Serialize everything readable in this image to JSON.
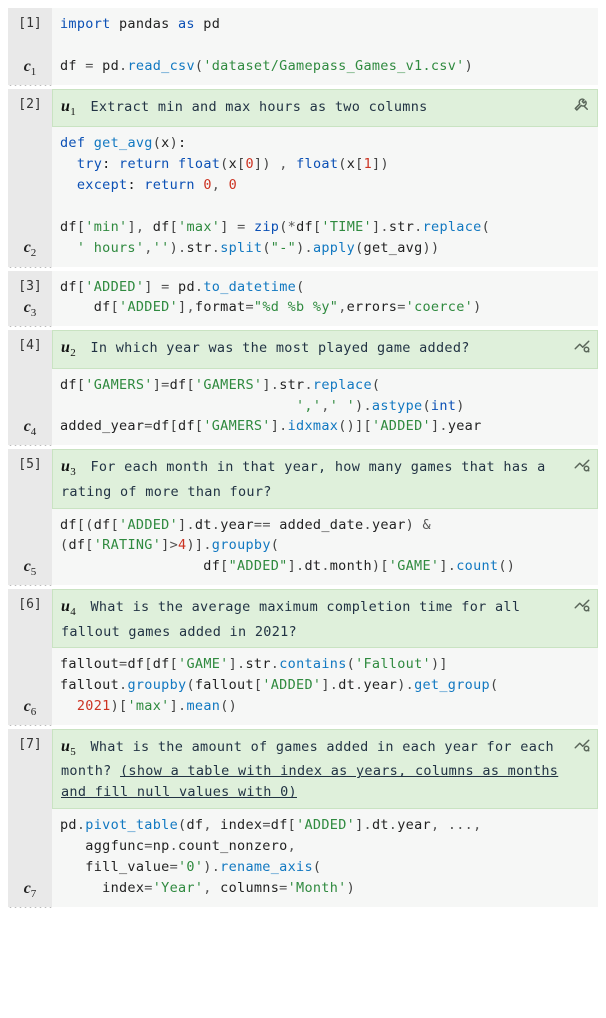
{
  "cells": [
    {
      "idx": "[1]",
      "clabel": "c",
      "csub": "1",
      "code_html": "<span class='line'><span class='kw'>import</span> pandas <span class='kw'>as</span> pd</span><span class='line'> </span><span class='line'>df <span class='op'>=</span> pd<span class='op'>.</span><span class='fn'>read_csv</span><span class='paren'>(</span><span class='st'>'dataset/Gamepass_Games_v1.csv'</span><span class='paren'>)</span></span>"
    },
    {
      "idx": "[2]",
      "clabel": "c",
      "csub": "2",
      "ulabel": "u",
      "usub": "1",
      "utter": "Extract min and max hours as two columns",
      "icon": "tools",
      "code_html": "<span class='line'><span class='kw'>def</span> <span class='fn'>get_avg</span><span class='paren'>(</span>x<span class='paren'>)</span>:</span><span class='line'>  <span class='kw'>try</span>: <span class='kw'>return</span> <span class='blt'>float</span><span class='paren'>(</span>x<span class='paren'>[</span><span class='num'>0</span><span class='paren'>]</span><span class='paren'>)</span> <span class='op'>,</span> <span class='blt'>float</span><span class='paren'>(</span>x<span class='paren'>[</span><span class='num'>1</span><span class='paren'>]</span><span class='paren'>)</span></span><span class='line'>  <span class='kw'>except</span>: <span class='kw'>return</span> <span class='num'>0</span><span class='op'>,</span> <span class='num'>0</span></span><span class='line'> </span><span class='line'>df<span class='paren'>[</span><span class='st'>'min'</span><span class='paren'>]</span><span class='op'>,</span> df<span class='paren'>[</span><span class='st'>'max'</span><span class='paren'>]</span> <span class='op'>=</span> <span class='blt'>zip</span><span class='paren'>(</span><span class='op'>*</span>df<span class='paren'>[</span><span class='st'>'TIME'</span><span class='paren'>]</span><span class='op'>.</span>str<span class='op'>.</span><span class='fn'>replace</span><span class='paren'>(</span></span><span class='line'>  <span class='st'>' hours'</span><span class='op'>,</span><span class='st'>''</span><span class='paren'>)</span><span class='op'>.</span>str<span class='op'>.</span><span class='fn'>split</span><span class='paren'>(</span><span class='st'>\"-\"</span><span class='paren'>)</span><span class='op'>.</span><span class='fn'>apply</span><span class='paren'>(</span>get_avg<span class='paren'>)</span><span class='paren'>)</span></span>"
    },
    {
      "idx": "[3]",
      "clabel": "c",
      "csub": "3",
      "code_html": "<span class='line'>df<span class='paren'>[</span><span class='st'>'ADDED'</span><span class='paren'>]</span> <span class='op'>=</span> pd<span class='op'>.</span><span class='fn'>to_datetime</span><span class='paren'>(</span></span><span class='line'>    df<span class='paren'>[</span><span class='st'>'ADDED'</span><span class='paren'>]</span><span class='op'>,</span>format<span class='op'>=</span><span class='st'>\"%d %b %y\"</span><span class='op'>,</span>errors<span class='op'>=</span><span class='st'>'coerce'</span><span class='paren'>)</span></span>"
    },
    {
      "idx": "[4]",
      "clabel": "c",
      "csub": "4",
      "ulabel": "u",
      "usub": "2",
      "utter": "In which year was the most played game added?",
      "icon": "analyze",
      "code_html": "<span class='line'>df<span class='paren'>[</span><span class='st'>'GAMERS'</span><span class='paren'>]</span><span class='op'>=</span>df<span class='paren'>[</span><span class='st'>'GAMERS'</span><span class='paren'>]</span><span class='op'>.</span>str<span class='op'>.</span><span class='fn'>replace</span><span class='paren'>(</span></span><span class='line'>                            <span class='st'>','</span><span class='op'>,</span><span class='st'>' '</span><span class='paren'>)</span><span class='op'>.</span><span class='fn'>astype</span><span class='paren'>(</span><span class='blt'>int</span><span class='paren'>)</span></span><span class='line'>added_year<span class='op'>=</span>df<span class='paren'>[</span>df<span class='paren'>[</span><span class='st'>'GAMERS'</span><span class='paren'>]</span><span class='op'>.</span><span class='fn'>idxmax</span><span class='paren'>(</span><span class='paren'>)</span><span class='paren'>]</span><span class='paren'>[</span><span class='st'>'ADDED'</span><span class='paren'>]</span><span class='op'>.</span>year</span>"
    },
    {
      "idx": "[5]",
      "clabel": "c",
      "csub": "5",
      "ulabel": "u",
      "usub": "3",
      "utter": "For each month in that year, how many games that has a rating of more than four?",
      "icon": "analyze",
      "code_html": "<span class='line'>df<span class='paren'>[</span><span class='paren'>(</span>df<span class='paren'>[</span><span class='st'>'ADDED'</span><span class='paren'>]</span><span class='op'>.</span>dt<span class='op'>.</span>year<span class='op'>==</span> added_date<span class='op'>.</span>year<span class='paren'>)</span> <span class='op'>&amp;</span></span><span class='line'><span class='paren'>(</span>df<span class='paren'>[</span><span class='st'>'RATING'</span><span class='paren'>]</span><span class='op'>&gt;</span><span class='num'>4</span><span class='paren'>)</span><span class='paren'>]</span><span class='op'>.</span><span class='fn'>groupby</span><span class='paren'>(</span></span><span class='line'>                 df<span class='paren'>[</span><span class='st'>\"ADDED\"</span><span class='paren'>]</span><span class='op'>.</span>dt<span class='op'>.</span>month<span class='paren'>)</span><span class='paren'>[</span><span class='st'>'GAME'</span><span class='paren'>]</span><span class='op'>.</span><span class='fn'>count</span><span class='paren'>(</span><span class='paren'>)</span></span>"
    },
    {
      "idx": "[6]",
      "clabel": "c",
      "csub": "6",
      "ulabel": "u",
      "usub": "4",
      "utter": "What is the average maximum completion time for all fallout games added in 2021?",
      "icon": "analyze",
      "code_html": "<span class='line'>fallout<span class='op'>=</span>df<span class='paren'>[</span>df<span class='paren'>[</span><span class='st'>'GAME'</span><span class='paren'>]</span><span class='op'>.</span>str<span class='op'>.</span><span class='fn'>contains</span><span class='paren'>(</span><span class='st'>'Fallout'</span><span class='paren'>)</span><span class='paren'>]</span></span><span class='line'>fallout<span class='op'>.</span><span class='fn'>groupby</span><span class='paren'>(</span>fallout<span class='paren'>[</span><span class='st'>'ADDED'</span><span class='paren'>]</span><span class='op'>.</span>dt<span class='op'>.</span>year<span class='paren'>)</span><span class='op'>.</span><span class='fn'>get_group</span><span class='paren'>(</span></span><span class='line'>  <span class='num'>2021</span><span class='paren'>)</span><span class='paren'>[</span><span class='st'>'max'</span><span class='paren'>]</span><span class='op'>.</span><span class='fn'>mean</span><span class='paren'>(</span><span class='paren'>)</span></span>"
    },
    {
      "idx": "[7]",
      "clabel": "c",
      "csub": "7",
      "ulabel": "u",
      "usub": "5",
      "utter_html": "What is the amount of games added in each year for each month? <span class='underline'>(show a table with index as years, columns as months and fill null values with 0)</span>",
      "icon": "analyze",
      "code_html": "<span class='line'>pd<span class='op'>.</span><span class='fn'>pivot_table</span><span class='paren'>(</span>df<span class='op'>,</span> index<span class='op'>=</span>df<span class='paren'>[</span><span class='st'>'ADDED'</span><span class='paren'>]</span><span class='op'>.</span>dt<span class='op'>.</span>year<span class='op'>,</span> <span class='op'>...,</span></span><span class='line'>   aggfunc<span class='op'>=</span>np<span class='op'>.</span>count_nonzero<span class='op'>,</span></span><span class='line'>   fill_value<span class='op'>=</span><span class='st'>'0'</span><span class='paren'>)</span><span class='op'>.</span><span class='fn'>rename_axis</span><span class='paren'>(</span></span><span class='line'>     index<span class='op'>=</span><span class='st'>'Year'</span><span class='op'>,</span> columns<span class='op'>=</span><span class='st'>'Month'</span><span class='paren'>)</span></span>"
    }
  ]
}
